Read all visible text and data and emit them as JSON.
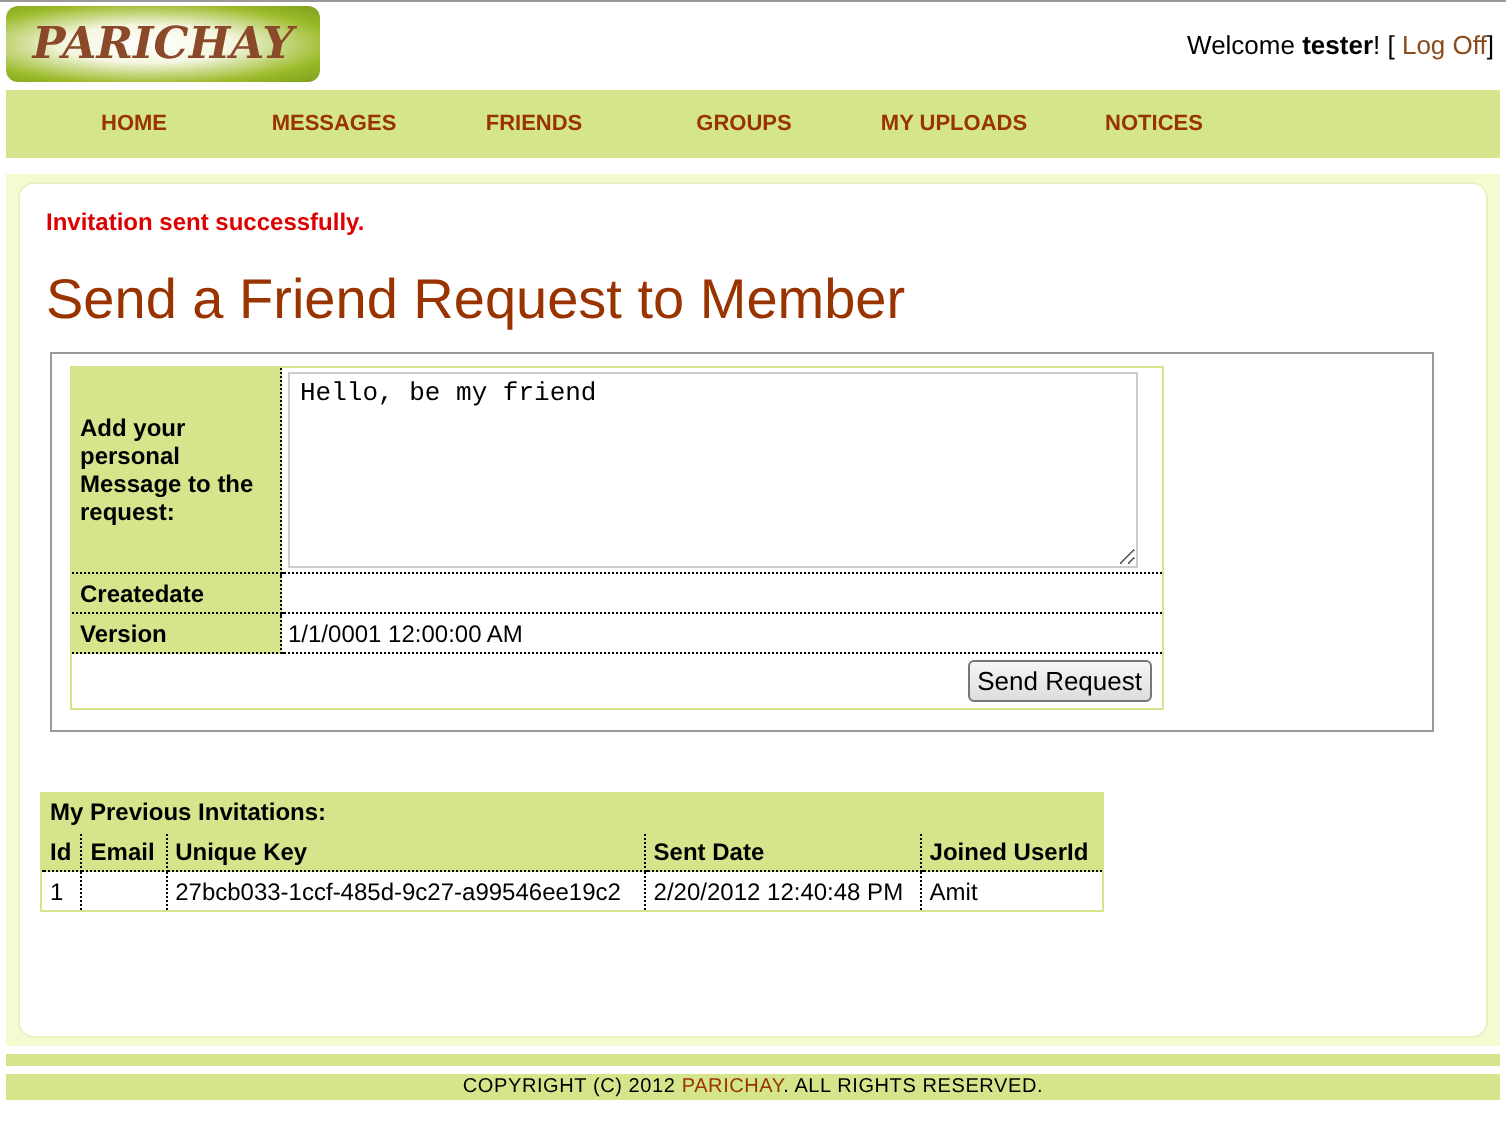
{
  "logo": {
    "text": "PARICHAY"
  },
  "welcome": {
    "text": "Welcome **tester**! [",
    "link": "Log Off",
    "end": "]"
  },
  "nav": [
    {
      "label": "HOME"
    },
    {
      "label": "MESSAGES"
    },
    {
      "label": "FRIENDS"
    },
    {
      "label": "GROUPS"
    },
    {
      "label": "MY UPLOADS"
    },
    {
      "label": "NOTICES"
    }
  ],
  "status_message": "Invitation sent successfully.",
  "heading": "Send a Friend Request to Member",
  "form": {
    "message_label": "Add your personal Message to the request:",
    "message_value": "Hello, be my friend",
    "fields": [
      {
        "label": "Createdate"
      },
      {
        "label": "Version",
        "value": "1/1/0001 12:00:00 AM"
      }
    ],
    "button": "Send Request"
  },
  "invitations": {
    "title": "My Previous Invitations:",
    "columns": [
      "Id",
      "Email",
      "Unique Key",
      "Sent Date",
      "Joined UserId"
    ],
    "rows": [
      [
        "1",
        null,
        "27bcb033-1ccf-485d-9c27-a99546ee19c2",
        "2/20/2012 12:40:48 PM",
        "Amit"
      ]
    ]
  },
  "footer": {
    "text": "COPYRIGHT (C) 2012",
    "link": "PARICHAY",
    "end": ". ALL RIGHTS RESERVED."
  }
}
